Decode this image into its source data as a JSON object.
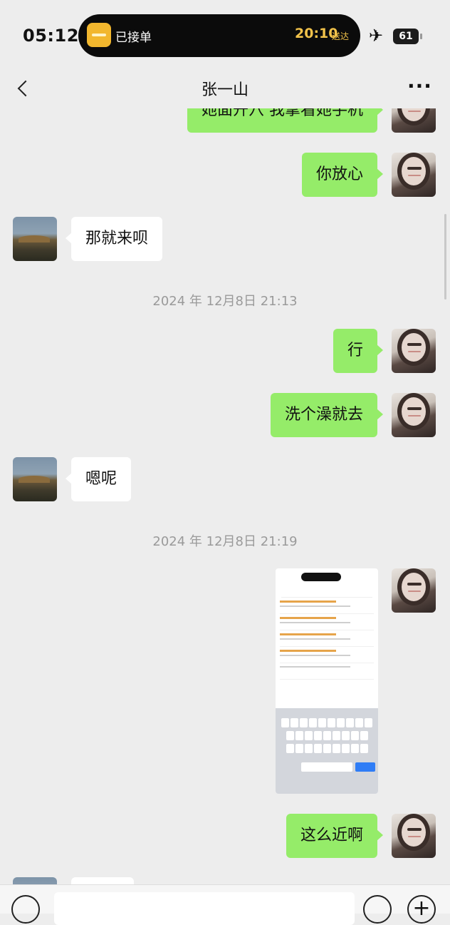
{
  "status_bar": {
    "time": "05:12",
    "island_label": "已接单",
    "island_time": "20:10",
    "island_sub": "送达",
    "battery": "61"
  },
  "nav": {
    "title": "张一山"
  },
  "messages": [
    {
      "side": "me",
      "text": "她面开穴 我拿看她手机"
    },
    {
      "side": "me",
      "text": "你放心"
    },
    {
      "side": "other",
      "text": "那就来呗"
    },
    {
      "timestamp": "2024 年 12月8日 21:13"
    },
    {
      "side": "me",
      "text": "行"
    },
    {
      "side": "me",
      "text": "洗个澡就去"
    },
    {
      "side": "other",
      "text": "嗯呢"
    },
    {
      "timestamp": "2024 年 12月8日 21:19"
    },
    {
      "side": "me",
      "type": "image",
      "description": "screenshot"
    },
    {
      "side": "me",
      "text": "这么近啊"
    }
  ],
  "input": {
    "placeholder": ""
  }
}
